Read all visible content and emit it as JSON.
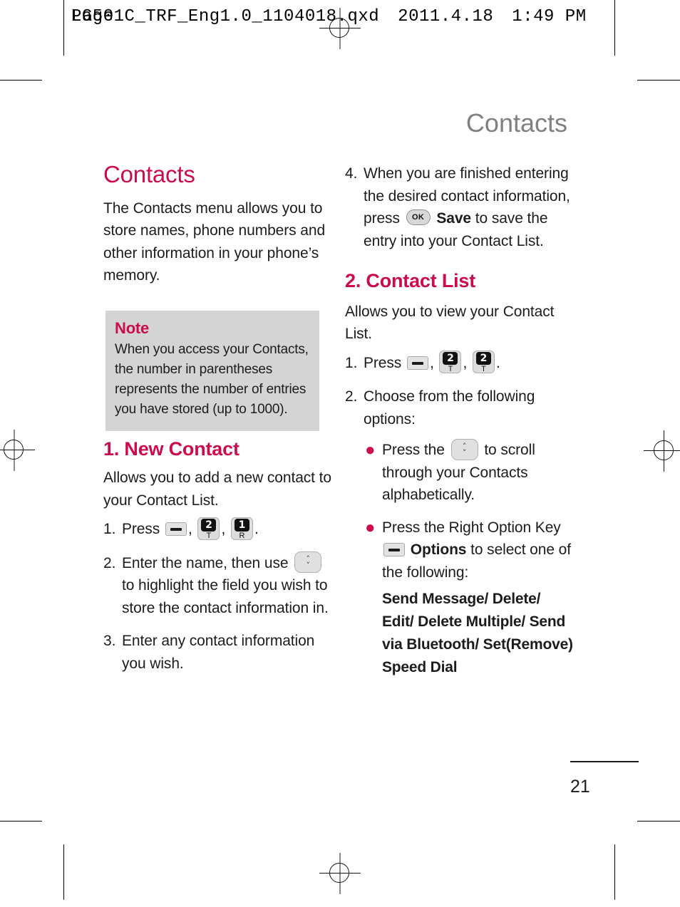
{
  "file_header": {
    "filename": "LG501C_TRF_Eng1.0_1104018.qxd",
    "date": "2011.4.18",
    "time": "1:49 PM",
    "page_label": "Page"
  },
  "running_head": "Contacts",
  "page_number": "21",
  "colors": {
    "accent": "#CC0B4F",
    "note_bg": "#d4d4d4",
    "running_head": "#808080",
    "body_text": "#1c1c1c"
  },
  "left_column": {
    "chapter_title": "Contacts",
    "intro": "The Contacts menu allows you to store names, phone numbers and other information in your phone’s memory.",
    "note": {
      "title": "Note",
      "text": "When you access your Contacts, the number in parentheses represents the number of entries you have stored (up to 1000)."
    },
    "section": {
      "heading": "1. New Contact",
      "description": "Allows you to add a new contact to your Contact List.",
      "steps": [
        {
          "num": "1.",
          "pre": "Press",
          "keys": [
            "softkey-left",
            "key-2-T",
            "key-1-R"
          ],
          "post": "."
        },
        {
          "num": "2.",
          "pre": "Enter the name, then use",
          "keys": [
            "nav-key-up-down"
          ],
          "post": "to highlight the field you wish to store the contact information in."
        },
        {
          "num": "3.",
          "pre": "Enter any contact information you wish.",
          "keys": [],
          "post": ""
        }
      ]
    }
  },
  "right_column": {
    "step4": {
      "num": "4.",
      "pre": "When you are finished entering the desired contact information, press",
      "key": "ok-key",
      "bold": "Save",
      "post": "to save the entry into your Contact List."
    },
    "section": {
      "heading": "2. Contact List",
      "description": "Allows you to view your Contact List.",
      "step1": {
        "num": "1.",
        "pre": "Press",
        "keys": [
          "softkey-left",
          "key-2-T",
          "key-2-T"
        ],
        "post": "."
      },
      "step2": {
        "num": "2.",
        "text": "Choose from the following options:"
      },
      "bullets": [
        {
          "pre": "Press the",
          "key": "nav-key-up-down",
          "post": "to scroll through your Contacts alphabetically."
        },
        {
          "pre": "Press the Right Option Key",
          "key": "softkey-right",
          "bold": "Options",
          "post": "to select one of the following:"
        }
      ],
      "options_list": "Send Message/ Delete/ Edit/ Delete Multiple/ Send via Bluetooth/ Set(Remove) Speed Dial"
    }
  },
  "key_icons": {
    "softkey_dash": "—",
    "key_2_digit": "2",
    "key_2_sub": "T",
    "key_1_digit": "1",
    "key_1_sub": "R",
    "nav_up": "˄",
    "nav_down": "˅",
    "ok_label": "OK"
  }
}
